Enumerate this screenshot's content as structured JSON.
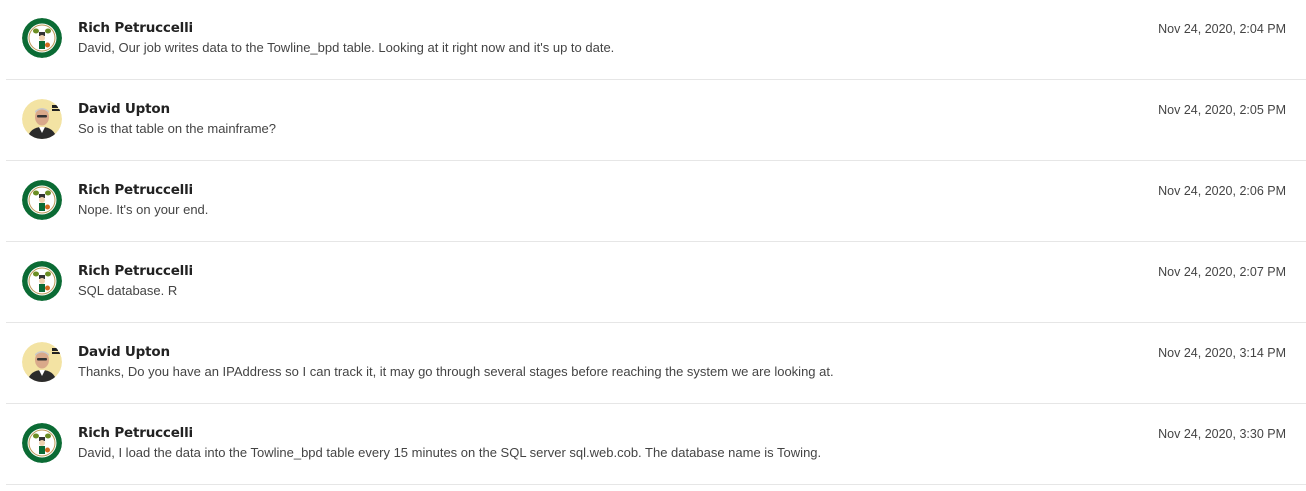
{
  "messages": [
    {
      "sender": "Rich Petruccelli",
      "avatar": "celtics-logo-icon",
      "text": "David, Our job writes data to the Towline_bpd table. Looking at it right now and it's up to date.",
      "time": "Nov 24, 2020, 2:04 PM"
    },
    {
      "sender": "David Upton",
      "avatar": "person-photo-icon",
      "text": "So is that table on the mainframe?",
      "time": "Nov 24, 2020, 2:05 PM"
    },
    {
      "sender": "Rich Petruccelli",
      "avatar": "celtics-logo-icon",
      "text": "Nope. It's on your end.",
      "time": "Nov 24, 2020, 2:06 PM"
    },
    {
      "sender": "Rich Petruccelli",
      "avatar": "celtics-logo-icon",
      "text": "SQL database. R",
      "time": "Nov 24, 2020, 2:07 PM"
    },
    {
      "sender": "David Upton",
      "avatar": "person-photo-icon",
      "text": "Thanks, Do you have an IPAddress so I can track it, it may go through several stages before reaching the system we are looking at.",
      "time": "Nov 24, 2020, 3:14 PM"
    },
    {
      "sender": "Rich Petruccelli",
      "avatar": "celtics-logo-icon",
      "text": "David, I load the data into the Towline_bpd table every 15 minutes on the SQL server sql.web.cob. The database name is Towing.",
      "time": "Nov 24, 2020, 3:30 PM"
    }
  ],
  "colors": {
    "celtics_green": "#007A33",
    "celtics_gold": "#BA9653",
    "divider": "#e6e6e6"
  }
}
